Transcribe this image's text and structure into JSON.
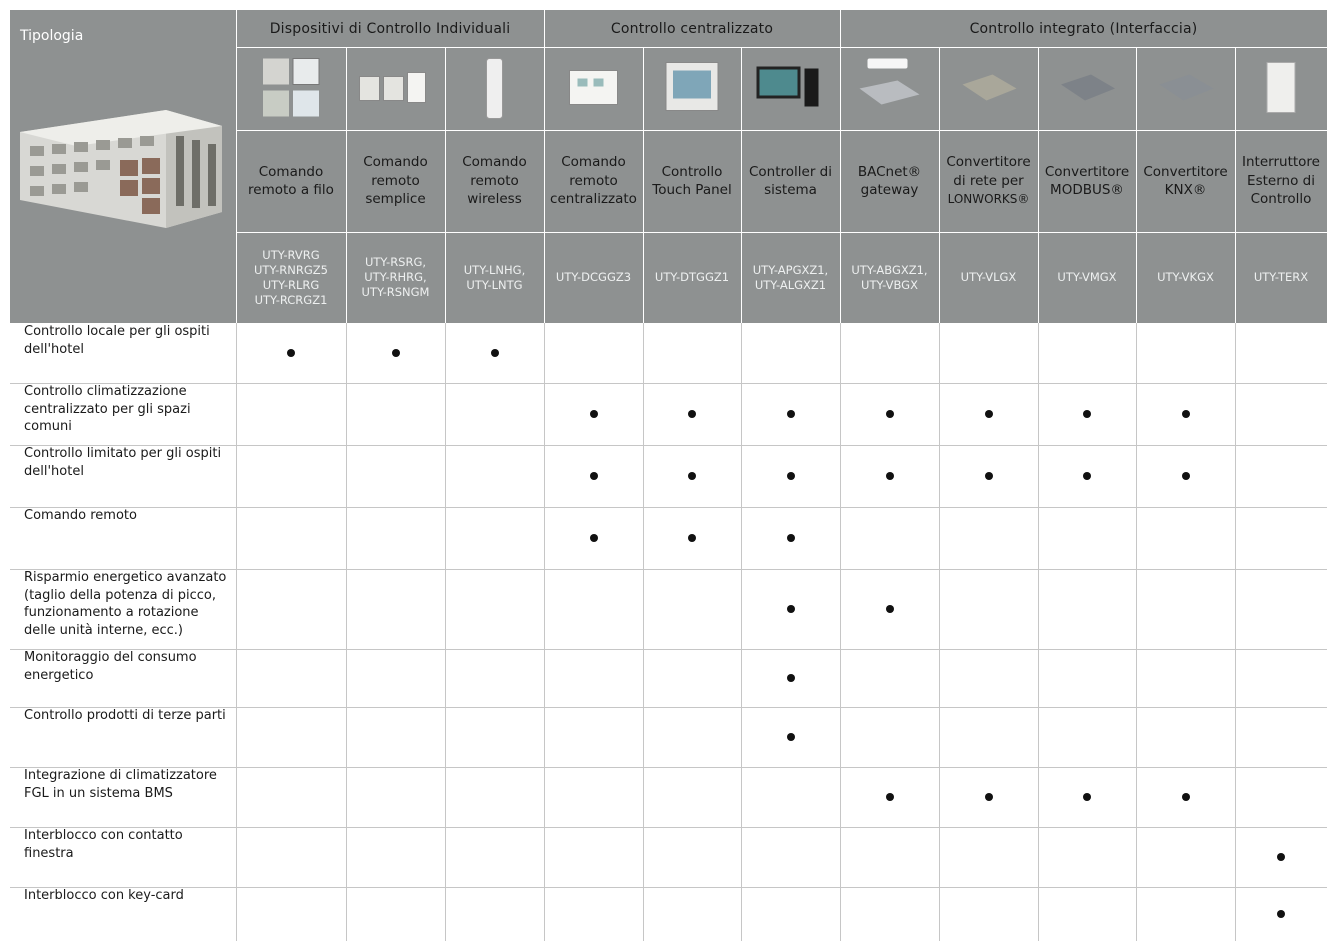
{
  "header": {
    "tipologia": "Tipologia",
    "groups": [
      "Dispositivi di Controllo Individuali",
      "Controllo centralizzato",
      "Controllo integrato (Interfaccia)"
    ]
  },
  "products": [
    {
      "name": [
        "Comando",
        "remoto a filo"
      ],
      "codes": [
        "UTY-RVRG",
        "UTY-RNRGZ5",
        "UTY-RLRG",
        "UTY-RCRGZ1"
      ],
      "image_icon": "wired-remote-controllers-image"
    },
    {
      "name": [
        "Comando",
        "remoto",
        "semplice"
      ],
      "codes": [
        "UTY-RSRG,",
        "UTY-RHRG,",
        "UTY-RSNGM"
      ],
      "image_icon": "simple-remote-controllers-image"
    },
    {
      "name": [
        "Comando",
        "remoto",
        "wireless"
      ],
      "codes": [
        "UTY-LNHG,",
        "UTY-LNTG"
      ],
      "image_icon": "wireless-remote-image"
    },
    {
      "name": [
        "Comando",
        "remoto",
        "centralizzato"
      ],
      "codes": [
        "UTY-DCGGZ3"
      ],
      "image_icon": "central-remote-image"
    },
    {
      "name": [
        "Controllo",
        "Touch Panel"
      ],
      "codes": [
        "UTY-DTGGZ1"
      ],
      "image_icon": "touch-panel-image"
    },
    {
      "name": [
        "Controller di",
        "sistema"
      ],
      "codes": [
        "UTY-APGXZ1,",
        "UTY-ALGXZ1"
      ],
      "image_icon": "system-controller-pc-image"
    },
    {
      "name": [
        "BACnet®",
        "gateway"
      ],
      "codes": [
        "UTY-ABGXZ1,",
        "UTY-VBGX"
      ],
      "image_icon": "bacnet-gateway-image"
    },
    {
      "name": [
        "Convertitore",
        "di rete per",
        "LONWORKS®"
      ],
      "codes": [
        "UTY-VLGX"
      ],
      "image_icon": "lonworks-converter-image"
    },
    {
      "name": [
        "Convertitore",
        "MODBUS®"
      ],
      "codes": [
        "UTY-VMGX"
      ],
      "image_icon": "modbus-converter-image"
    },
    {
      "name": [
        "Convertitore",
        "KNX®"
      ],
      "codes": [
        "UTY-VKGX"
      ],
      "image_icon": "knx-converter-image"
    },
    {
      "name": [
        "Interruttore",
        "Esterno di",
        "Controllo"
      ],
      "codes": [
        "UTY-TERX"
      ],
      "image_icon": "external-switch-image"
    }
  ],
  "rows": [
    {
      "label": [
        "Controllo locale per gli ospiti",
        "dell'hotel"
      ],
      "marks": [
        1,
        1,
        1,
        0,
        0,
        0,
        0,
        0,
        0,
        0,
        0
      ]
    },
    {
      "label": [
        "Controllo climatizzazione",
        "centralizzato per gli spazi",
        "comuni"
      ],
      "marks": [
        0,
        0,
        0,
        1,
        1,
        1,
        1,
        1,
        1,
        1,
        0
      ]
    },
    {
      "label": [
        "Controllo limitato per gli ospiti",
        "dell'hotel"
      ],
      "marks": [
        0,
        0,
        0,
        1,
        1,
        1,
        1,
        1,
        1,
        1,
        0
      ]
    },
    {
      "label": [
        "Comando remoto"
      ],
      "marks": [
        0,
        0,
        0,
        1,
        1,
        1,
        0,
        0,
        0,
        0,
        0
      ]
    },
    {
      "label": [
        "Risparmio energetico avanzato",
        "(taglio della potenza di picco,",
        "funzionamento a rotazione",
        "delle unità interne, ecc.)"
      ],
      "marks": [
        0,
        0,
        0,
        0,
        0,
        1,
        1,
        0,
        0,
        0,
        0
      ]
    },
    {
      "label": [
        "Monitoraggio del consumo",
        "energetico"
      ],
      "marks": [
        0,
        0,
        0,
        0,
        0,
        1,
        0,
        0,
        0,
        0,
        0
      ]
    },
    {
      "label": [
        "Controllo prodotti di terze parti"
      ],
      "marks": [
        0,
        0,
        0,
        0,
        0,
        1,
        0,
        0,
        0,
        0,
        0
      ]
    },
    {
      "label": [
        "Integrazione di climatizzatore",
        "FGL in un sistema BMS"
      ],
      "marks": [
        0,
        0,
        0,
        0,
        0,
        0,
        1,
        1,
        1,
        1,
        0
      ]
    },
    {
      "label": [
        "Interblocco con contatto",
        "finestra"
      ],
      "marks": [
        0,
        0,
        0,
        0,
        0,
        0,
        0,
        0,
        0,
        0,
        1
      ]
    },
    {
      "label": [
        "Interblocco con key-card"
      ],
      "marks": [
        0,
        0,
        0,
        0,
        0,
        0,
        0,
        0,
        0,
        0,
        1
      ]
    }
  ],
  "colors": {
    "header_bg": "#8e9191",
    "grid_line": "#c6c6c6",
    "dot": "#111111"
  },
  "building_image_icon": "hotel-building-image"
}
